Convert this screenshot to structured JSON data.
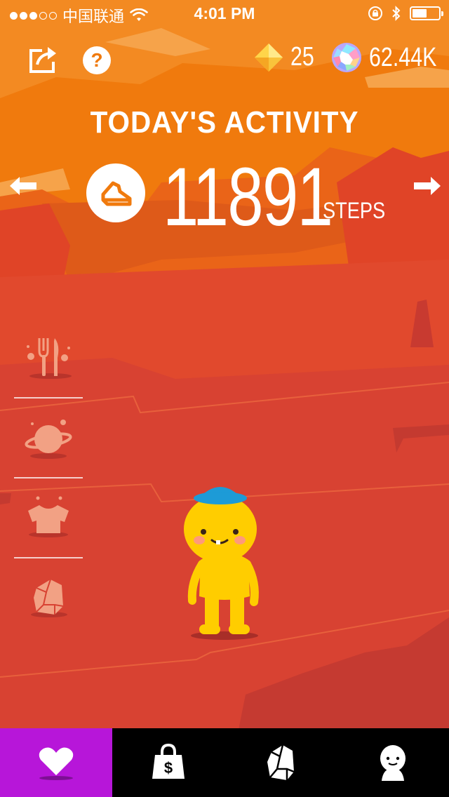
{
  "status_bar": {
    "carrier": "中国联通",
    "time": "4:01 PM",
    "battery_level": 0.55
  },
  "top_bar": {
    "share_icon": "share-icon",
    "help_icon": "help-icon",
    "help_glyph": "?",
    "gems": "25",
    "crystals": "62.44K"
  },
  "activity": {
    "title": "TODAY'S ACTIVITY",
    "steps": "11891",
    "steps_label": "STEPS"
  },
  "side_menu": {
    "items": [
      "food-icon",
      "planet-icon",
      "shirt-icon",
      "crystal-rock-icon"
    ]
  },
  "tabs": [
    {
      "icon": "heart-icon",
      "active": true
    },
    {
      "icon": "shop-bag-icon",
      "active": false,
      "glyph": "$"
    },
    {
      "icon": "crystal-rock-icon",
      "active": false
    },
    {
      "icon": "character-icon",
      "active": false
    }
  ],
  "colors": {
    "sky": "#f07a0d",
    "ground": "#d84232",
    "tab_active": "#b716d9",
    "character": "#ffcd00",
    "hat": "#1d9bd7"
  }
}
